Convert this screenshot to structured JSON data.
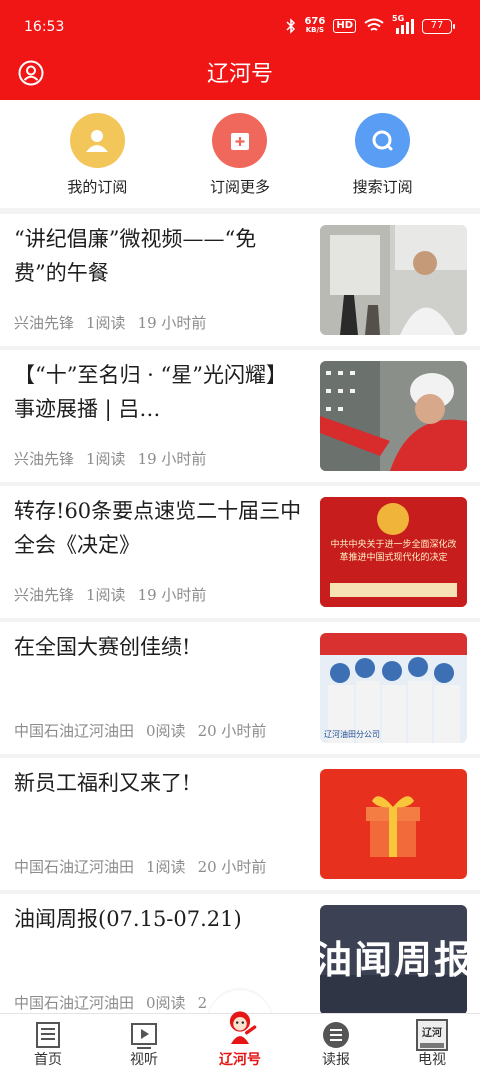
{
  "status_bar": {
    "time": "16:53",
    "net_speed": "676",
    "net_unit": "KB/S",
    "hd": "HD",
    "signal": "5G",
    "battery": "77"
  },
  "header": {
    "title": "辽河号"
  },
  "subscriptions": [
    {
      "label": "我的订阅",
      "icon": "person-icon",
      "color": "#f3c65a"
    },
    {
      "label": "订阅更多",
      "icon": "add-box-icon",
      "color": "#f0685c"
    },
    {
      "label": "搜索订阅",
      "icon": "search-icon",
      "color": "#5a9df5"
    }
  ],
  "articles": [
    {
      "title": "“讲纪倡廉”微视频——“免费”的午餐",
      "source": "兴油先锋",
      "reads": "1阅读",
      "time": "19 小时前"
    },
    {
      "title": "【“十”至名归 · “星”光闪耀】事迹展播 | 吕…",
      "source": "兴油先锋",
      "reads": "1阅读",
      "time": "19 小时前"
    },
    {
      "title": "转存!60条要点速览二十届三中全会《决定》",
      "source": "兴油先锋",
      "reads": "1阅读",
      "time": "19 小时前",
      "thumb_text": "中共中央关于进一步全面深化改革推进中国式现代化的决定"
    },
    {
      "title": "在全国大赛创佳绩!",
      "source": "中国石油辽河油田",
      "reads": "0阅读",
      "time": "20 小时前",
      "thumb_text": "辽河油田分公司"
    },
    {
      "title": "新员工福利又来了!",
      "source": "中国石油辽河油田",
      "reads": "1阅读",
      "time": "20 小时前"
    },
    {
      "title": "油闻周报(07.15-07.21)",
      "source": "中国石油辽河油田",
      "reads": "0阅读",
      "time": "2",
      "thumb_text": "油闻周报"
    }
  ],
  "bottom_nav": [
    {
      "label": "首页",
      "icon": "newspaper-icon",
      "active": false
    },
    {
      "label": "视听",
      "icon": "video-play-icon",
      "active": false
    },
    {
      "label": "辽河号",
      "icon": "mascot-icon",
      "active": true
    },
    {
      "label": "读报",
      "icon": "list-icon",
      "active": false
    },
    {
      "label": "电视",
      "icon": "tv-icon",
      "active": false,
      "badge": "辽河"
    }
  ],
  "colors": {
    "brand_red": "#f01616",
    "active_tab": "#e51616",
    "meta_gray": "#8c8c8c"
  }
}
